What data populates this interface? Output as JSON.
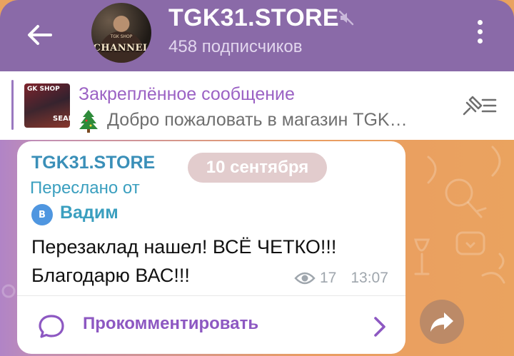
{
  "header": {
    "title": "TGK31.STORE",
    "subscribers": "458 подписчиков",
    "avatar_caption": "CHANNEL",
    "avatar_sub": "TGK SHOP"
  },
  "pinned": {
    "label": "Закреплённое сообщение",
    "text": "Добро пожаловать в магазин TGK…",
    "thumb_top": "GK SHOP",
    "thumb_bottom": "SEAR"
  },
  "message": {
    "sender": "TGK31.STORE",
    "date": "10 сентября",
    "forwarded_label": "Переслано от",
    "forwarded_initial": "В",
    "forwarded_name": "Вадим",
    "lines": [
      "Перезаклад нашел! ВСЁ ЧЕТКО!!!",
      "Благодарю ВАС!!!"
    ],
    "views": "17",
    "time": "13:07"
  },
  "comments": {
    "label": "Прокомментировать"
  },
  "colors": {
    "header": "#8a6aa8",
    "accent_purple": "#9b62c4",
    "link_blue": "#3a8fb8",
    "chat_orange": "#e99d62"
  },
  "icons": {
    "back": "back-arrow-icon",
    "mute": "muted-speaker-icon",
    "menu": "more-vertical-icon",
    "pin": "pin-list-icon",
    "views": "eye-icon",
    "comment": "speech-bubble-icon",
    "chevron": "chevron-right-icon",
    "share": "share-arrow-icon"
  }
}
